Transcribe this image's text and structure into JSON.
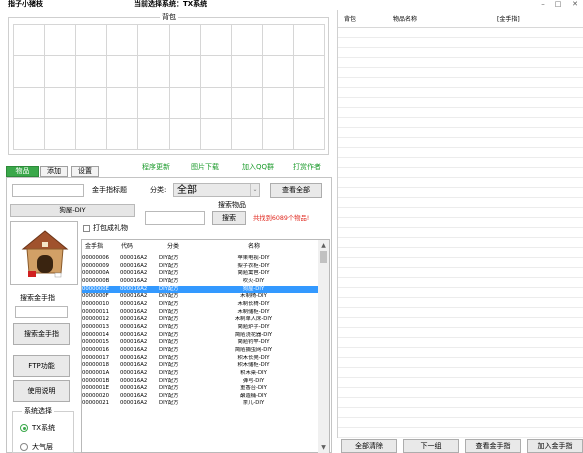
{
  "titlebar": {
    "app_title": "指子小猪枝",
    "system_text": "当前选择系统：TX系统",
    "minimize": "–",
    "maximize": "□",
    "close": "✕"
  },
  "backpack": {
    "title": "背包"
  },
  "tabs": [
    {
      "label": "物品"
    },
    {
      "label": "添加"
    },
    {
      "label": "设置"
    }
  ],
  "links": {
    "program_update": "程序更新",
    "image_download": "图片下载",
    "join_qq": "加入QQ群",
    "open_work": "打赏作者"
  },
  "filter": {
    "search_input_value": "",
    "gold_title_label": "金手指标题",
    "category_label": "分类:",
    "category_value": "全部",
    "view_all_button": "查看全部"
  },
  "item_name_box": "狗屋-DIY",
  "pack_gift_label": "打包成礼物",
  "search_items": {
    "title": "搜索物品",
    "input_value": "",
    "button": "搜索",
    "result_text": "共找到6089个物品!"
  },
  "left_panel": {
    "search_gold_label": "搜索金手指",
    "search_gold_input": "",
    "search_gold_button": "搜索金手指",
    "ftp_button": "FTP功能",
    "help_button": "使用说明",
    "system_select_label": "系统选择",
    "radio_tx": "TX系统",
    "radio_other": "大气层"
  },
  "item_table": {
    "columns": [
      "金手指",
      "代码",
      "分类",
      "名称"
    ],
    "rows": [
      [
        "00000006",
        "000016A2",
        "DIY配方",
        "苹果电视-DIY"
      ],
      [
        "00000009",
        "000016A2",
        "DIY配方",
        "梨子衣柜-DIY"
      ],
      [
        "0000000A",
        "000016A2",
        "DIY配方",
        "简陋篱笆-DIY"
      ],
      [
        "0000000B",
        "000016A2",
        "DIY配方",
        "吹火-DIY"
      ],
      [
        "0000000E",
        "000016A2",
        "DIY配方",
        "狗屋-DIY"
      ],
      [
        "0000000F",
        "000016A2",
        "DIY配方",
        "木制椅-DIY"
      ],
      [
        "00000010",
        "000016A2",
        "DIY配方",
        "木制长椅-DIY"
      ],
      [
        "00000011",
        "000016A2",
        "DIY配方",
        "木制储柜-DIY"
      ],
      [
        "00000012",
        "000016A2",
        "DIY配方",
        "木制单人床-DIY"
      ],
      [
        "00000013",
        "000016A2",
        "DIY配方",
        "简陋炉子-DIY"
      ],
      [
        "00000014",
        "000016A2",
        "DIY配方",
        "简陋浇花器-DIY"
      ],
      [
        "00000015",
        "000016A2",
        "DIY配方",
        "简陋钓竿-DIY"
      ],
      [
        "00000016",
        "000016A2",
        "DIY配方",
        "简陋捕虫网-DIY"
      ],
      [
        "00000017",
        "000016A2",
        "DIY配方",
        "积木长凳-DIY"
      ],
      [
        "00000018",
        "000016A2",
        "DIY配方",
        "积木储柜-DIY"
      ],
      [
        "0000001A",
        "000016A2",
        "DIY配方",
        "积木桌-DIY"
      ],
      [
        "0000001B",
        "000016A2",
        "DIY配方",
        "弹弓-DIY"
      ],
      [
        "0000001E",
        "000016A2",
        "DIY配方",
        "重香台-DIY"
      ],
      [
        "00000020",
        "000016A2",
        "DIY配方",
        "酿造桶-DIY"
      ],
      [
        "00000021",
        "000016A2",
        "DIY配方",
        "茶几-DIY"
      ]
    ],
    "selected_index": 4
  },
  "right_panel": {
    "columns": [
      "背包",
      "物品名称",
      "[金手指]"
    ],
    "buttons": {
      "clear_all": "全部清除",
      "next_page": "下一组",
      "view_gold": "查看金手指",
      "add_gold": "加入金手指"
    }
  },
  "colors": {
    "accent_green": "#3aa84a",
    "selection_blue": "#3399ff",
    "result_red": "#e0261c"
  }
}
